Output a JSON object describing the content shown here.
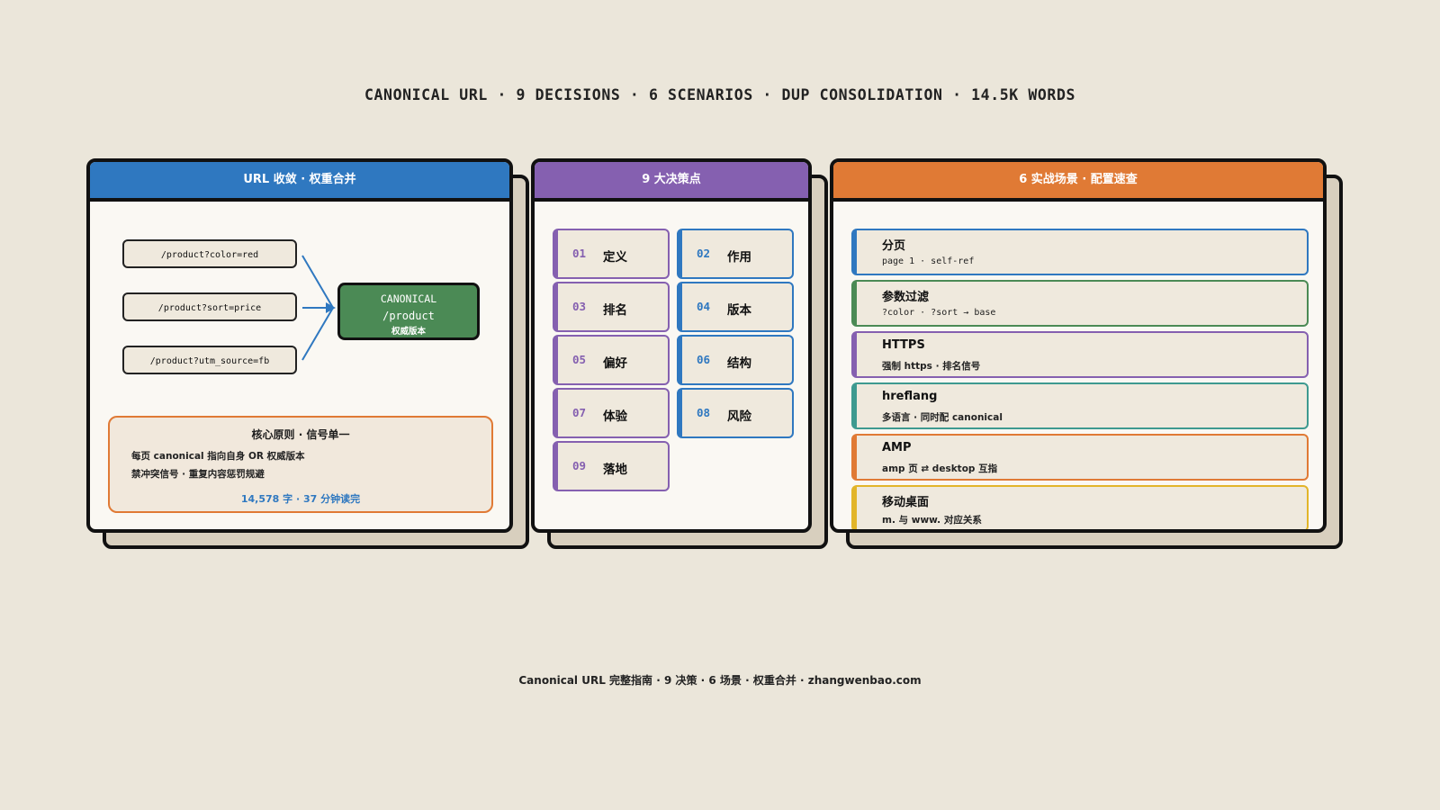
{
  "title": "CANONICAL URL · 9 DECISIONS · 6 SCENARIOS · DUP CONSOLIDATION · 14.5K WORDS",
  "colors": {
    "blue": "#2f78c0",
    "purple": "#8560b0",
    "orange": "#e07a35",
    "green": "#4b8a55",
    "teal": "#3e9a90",
    "yellow": "#e2b52a",
    "background": "#ebe6da"
  },
  "panel_consolidation": {
    "header": "URL 收敛 · 权重合并",
    "variants": [
      "/product?color=red",
      "/product?sort=price",
      "/product?utm_source=fb"
    ],
    "canonical": {
      "label": "CANONICAL",
      "path": "/product",
      "caption": "权威版本"
    },
    "principle": {
      "title": "核心原则 · 信号单一",
      "lines": [
        "每页 canonical 指向自身 OR 权威版本",
        "禁冲突信号 · 重复内容惩罚规避"
      ],
      "meta": "14,578 字 · 37 分钟读完"
    }
  },
  "panel_decisions": {
    "header": "9 大决策点",
    "items": [
      {
        "num": "01",
        "label": "定义"
      },
      {
        "num": "02",
        "label": "作用"
      },
      {
        "num": "03",
        "label": "排名"
      },
      {
        "num": "04",
        "label": "版本"
      },
      {
        "num": "05",
        "label": "偏好"
      },
      {
        "num": "06",
        "label": "结构"
      },
      {
        "num": "07",
        "label": "体验"
      },
      {
        "num": "08",
        "label": "风险"
      },
      {
        "num": "09",
        "label": "落地"
      }
    ]
  },
  "panel_scenarios": {
    "header": "6 实战场景 · 配置速查",
    "items": [
      {
        "title": "分页",
        "desc": "page 1 · self-ref"
      },
      {
        "title": "参数过滤",
        "desc": "?color · ?sort → base"
      },
      {
        "title": "HTTPS",
        "desc": "强制 https · 排名信号"
      },
      {
        "title": "hreflang",
        "desc": "多语言 · 同时配 canonical"
      },
      {
        "title": "AMP",
        "desc": "amp 页 ⇄ desktop 互指"
      },
      {
        "title": "移动桌面",
        "desc": "m. 与 www. 对应关系"
      }
    ]
  },
  "footer": "Canonical URL 完整指南 · 9 决策 · 6 场景 · 权重合并 · zhangwenbao.com"
}
